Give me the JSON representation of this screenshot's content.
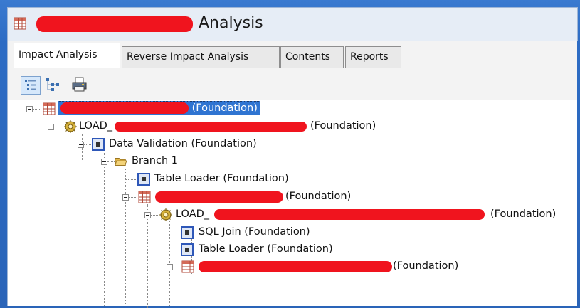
{
  "window": {
    "title_suffix": "Analysis",
    "icon": "table-grid-icon"
  },
  "tabs": [
    {
      "label": "Impact Analysis",
      "active": true
    },
    {
      "label": "Reverse Impact Analysis",
      "active": false
    },
    {
      "label": "Contents",
      "active": false
    },
    {
      "label": "Reports",
      "active": false
    }
  ],
  "toolbar": {
    "buttons": [
      "tree-view-icon",
      "diagram-view-icon",
      "print-icon"
    ]
  },
  "tree": {
    "nodes": [
      {
        "label": "(Foundation)",
        "icon": "table-grid-icon",
        "redacted": true,
        "selected": true
      },
      {
        "label": "LOAD_",
        "suffix": "(Foundation)",
        "icon": "job-gear-icon",
        "redacted": true
      },
      {
        "label": "Data Validation (Foundation)",
        "icon": "transform-node-icon"
      },
      {
        "label": "Branch 1",
        "icon": "folder-open-icon"
      },
      {
        "label": "Table Loader (Foundation)",
        "icon": "transform-node-icon"
      },
      {
        "label": "(Foundation)",
        "icon": "table-grid-icon",
        "redacted": true
      },
      {
        "label": "LOAD_",
        "suffix": "(Foundation)",
        "icon": "job-gear-icon",
        "redacted": true
      },
      {
        "label": "SQL Join (Foundation)",
        "icon": "transform-node-icon"
      },
      {
        "label": "Table Loader (Foundation)",
        "icon": "transform-node-icon"
      },
      {
        "label": "(Foundation)",
        "icon": "table-grid-icon",
        "redacted": true
      }
    ]
  },
  "colors": {
    "desktop_blue": "#2a64b8",
    "redaction_red": "#f0141e",
    "selection_blue": "#2f74d1"
  }
}
